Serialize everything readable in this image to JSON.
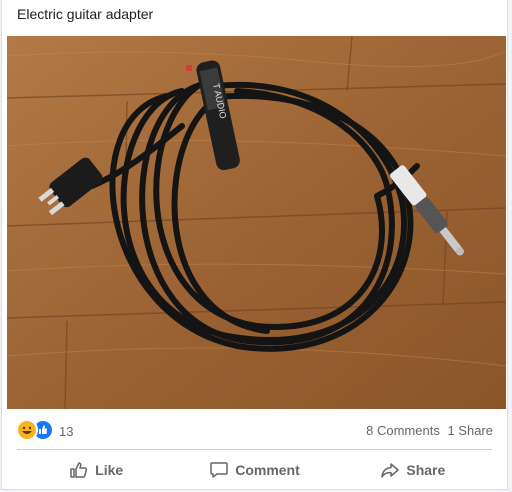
{
  "post": {
    "text": "Electric guitar adapter"
  },
  "photo": {
    "subject": "black cable with plug",
    "strap_text": "T AUDIO"
  },
  "reactions": {
    "icons": [
      "haha-icon",
      "like-icon"
    ],
    "count": "13"
  },
  "stats": {
    "comments": "8 Comments",
    "shares": "1 Share"
  },
  "actions": {
    "like": "Like",
    "comment": "Comment",
    "share": "Share"
  },
  "colors": {
    "like_blue": "#1877f2",
    "haha_yellow": "#f7b125",
    "muted_text": "#65676b"
  }
}
